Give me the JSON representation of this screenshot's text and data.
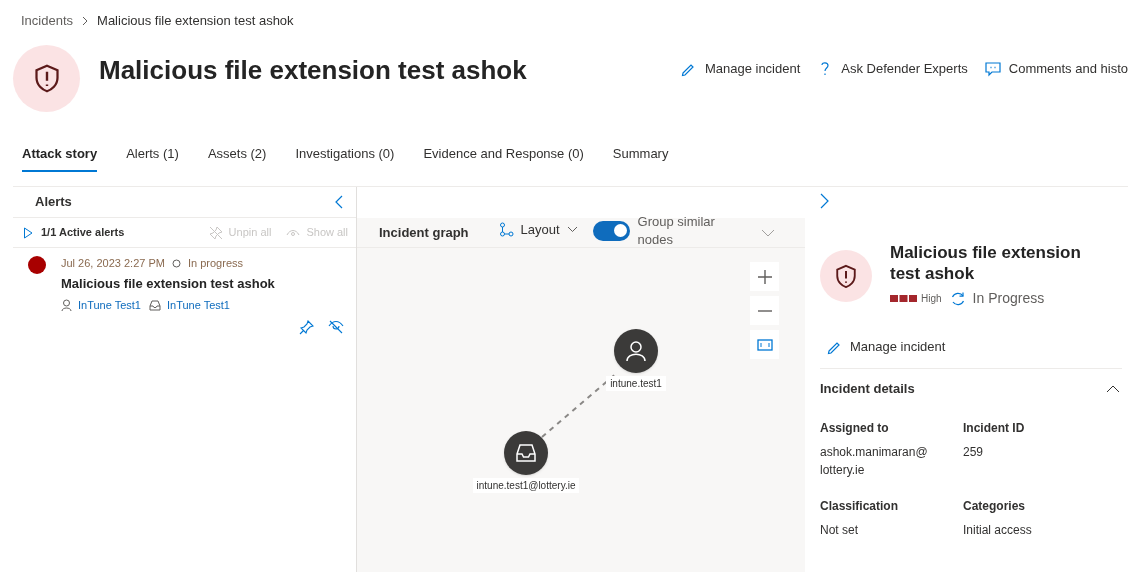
{
  "breadcrumb": [
    "Incidents",
    "Malicious file extension test ashok"
  ],
  "title": "Malicious file extension test ashok",
  "actions": [
    {
      "kind": "edit",
      "label": "Manage incident"
    },
    {
      "kind": "help",
      "label": "Ask Defender Experts"
    },
    {
      "kind": "comment",
      "label": "Comments and histo"
    }
  ],
  "tabs": [
    {
      "label": "Attack story",
      "selected": true
    },
    {
      "label": "Alerts (1)",
      "selected": false
    },
    {
      "label": "Assets (2)",
      "selected": false
    },
    {
      "label": "Investigations (0)",
      "selected": false
    },
    {
      "label": "Evidence and Response (0)",
      "selected": false
    },
    {
      "label": "Summary",
      "selected": false
    }
  ],
  "alerts_panel": {
    "title": "Alerts",
    "active": "1/1 Active alerts",
    "unpin": "Unpin all",
    "show_all": "Show all",
    "items": [
      {
        "time": "Jul 26, 2023 2:27 PM",
        "status": "In progress",
        "title": "Malicious file extension test ashok",
        "user": "InTune Test1",
        "mailbox": "InTune Test1",
        "color": "#a80000"
      }
    ]
  },
  "graph": {
    "title": "Incident graph",
    "layout": "Layout",
    "group_toggle": {
      "label": "Group similar nodes",
      "on": true
    },
    "nodes": [
      {
        "kind": "user",
        "label": "intune.test1"
      },
      {
        "kind": "mailbox",
        "label": "intune.test1@lottery.ie"
      }
    ]
  },
  "details": {
    "title": "Malicious file extension test ashok",
    "severity": "High",
    "status": "In Progress",
    "manage": "Manage incident",
    "section": "Incident details",
    "fields": [
      {
        "label": "Assigned to",
        "value": "ashok.manimaran@ lottery.ie"
      },
      {
        "label": "Incident ID",
        "value": "259"
      },
      {
        "label": "Classification",
        "value": "Not set"
      },
      {
        "label": "Categories",
        "value": "Initial access"
      }
    ]
  }
}
